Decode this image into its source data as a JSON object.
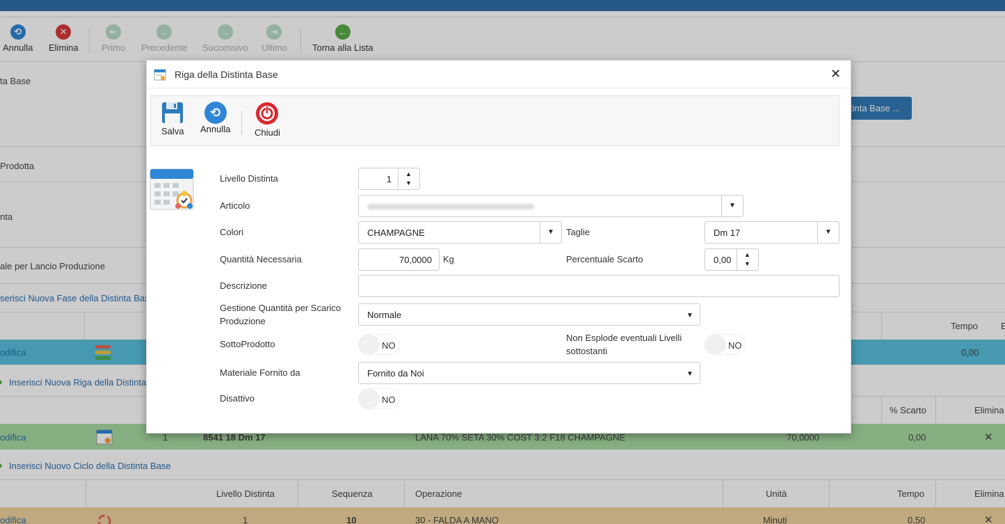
{
  "toolbar": {
    "annulla": "Annulla",
    "elimina": "Elimina",
    "primo": "Primo",
    "precedente": "Precedente",
    "successivo": "Successivo",
    "ultimo": "Ultimo",
    "torna": "Torna alla Lista"
  },
  "background": {
    "label_distinta_base": "ta Base",
    "label_prodotta": "Prodotta",
    "label_nta": "nta",
    "label_lancio": "ale per Lancio Produzione",
    "link_fase": "serisci Nuova Fase della Distinta Base",
    "link_riga": "Inserisci Nuova Riga della Distinta",
    "link_ciclo": "Inserisci Nuovo Ciclo della Distinta Base",
    "blue_button": "tinta Base ...",
    "modifica": "odifica",
    "fase_row": {
      "tempo_header": "Tempo",
      "e_header": "E",
      "tempo": "0,00"
    },
    "riga_row": {
      "scarto_header": "% Scarto",
      "elimina_header": "Elimina",
      "livello": "1",
      "codice": "8541 18 Dm 17",
      "descrizione": "LANA 70% SETA 30% COST 3:2 F18 CHAMPAGNE",
      "quantita": "70,0000",
      "scarto": "0,00",
      "delete": "✕"
    },
    "ciclo_header": {
      "livello": "Livello Distinta",
      "sequenza": "Sequenza",
      "operazione": "Operazione",
      "unita": "Unità",
      "tempo": "Tempo",
      "elimina": "Elimina"
    },
    "ciclo_row": {
      "livello": "1",
      "sequenza": "10",
      "operazione": "30 - FALDA A MANO",
      "unita": "Minuti",
      "tempo": "0,50",
      "delete": "✕"
    }
  },
  "modal": {
    "title": "Riga della Distinta Base",
    "close": "✕",
    "buttons": {
      "salva": "Salva",
      "annulla": "Annulla",
      "chiudi": "Chiudi"
    },
    "fields": {
      "livello_label": "Livello Distinta",
      "livello_value": "1",
      "articolo_label": "Articolo",
      "colori_label": "Colori",
      "colori_value": "CHAMPAGNE",
      "taglie_label": "Taglie",
      "taglie_value": "Dm 17",
      "quantita_label": "Quantità Necessaria",
      "quantita_value": "70,0000",
      "quantita_unit": "Kg",
      "percentuale_label": "Percentuale Scarto",
      "percentuale_value": "0,00",
      "descrizione_label": "Descrizione",
      "descrizione_value": "",
      "gestione_label_1": "Gestione Quantità per Scarico",
      "gestione_label_2": "Produzione",
      "gestione_value": "Normale",
      "sottoprodotto_label": "SottoProdotto",
      "sottoprodotto_value": "NO",
      "esplode_label_1": "Non Esplode eventuali Livelli",
      "esplode_label_2": "sottostanti",
      "esplode_value": "NO",
      "materiale_label": "Materiale Fornito da",
      "materiale_value": "Fornito da Noi",
      "disattivo_label": "Disattivo",
      "disattivo_value": "NO"
    }
  },
  "colors": {
    "fase_band": "#58c0dc",
    "riga_band": "#a8dba3",
    "ciclo_band": "#f0d49e",
    "annulla_icon": "#2f86d6",
    "elimina_icon": "#d83a3a",
    "torna_icon": "#5aaa4a",
    "chiudi_icon": "#d8282e"
  }
}
